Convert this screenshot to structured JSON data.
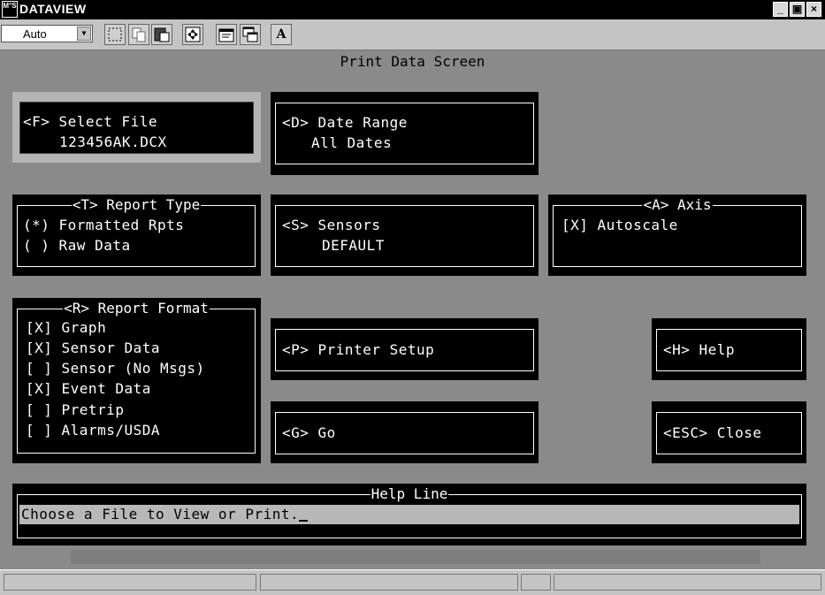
{
  "window": {
    "app_icon_text": "M°S",
    "title": "DATAVIEW",
    "minimize_label": "_",
    "maximize_label": "▣",
    "close_label": "×"
  },
  "toolbar": {
    "zoom_value": "Auto",
    "font_button_label": "A",
    "icons": [
      "select-box-icon",
      "copy-icon",
      "paste-icon",
      "fit-to-window-icon",
      "properties-icon",
      "window-arrange-icon",
      "font-icon"
    ]
  },
  "screen": {
    "title": "Print Data Screen",
    "select_file": {
      "label": "<F> Select File",
      "value": "123456AK.DCX"
    },
    "date_range": {
      "label": "<D> Date Range",
      "value": "All Dates"
    },
    "report_type": {
      "title": "<T> Report Type",
      "options": [
        "(*) Formatted Rpts",
        "( ) Raw Data"
      ]
    },
    "sensors": {
      "label": "<S> Sensors",
      "value": "DEFAULT"
    },
    "axis": {
      "title": "<A> Axis",
      "autoscale": "[X] Autoscale"
    },
    "report_format": {
      "title": "<R> Report Format",
      "items": [
        "[X] Graph",
        "[X] Sensor Data",
        "[ ] Sensor (No Msgs)",
        "[X] Event Data",
        "[ ] Pretrip",
        "[ ] Alarms/USDA"
      ]
    },
    "printer_setup": "<P> Printer Setup",
    "help": "<H> Help",
    "go": "<G> Go",
    "close": "<ESC> Close",
    "help_line": {
      "title": "Help Line",
      "text": "Choose a File to View or Print."
    }
  },
  "colors": {
    "background": "#8a8a8a",
    "panel": "#000000",
    "text": "#ffffff",
    "focus": "#b4b4b4"
  }
}
